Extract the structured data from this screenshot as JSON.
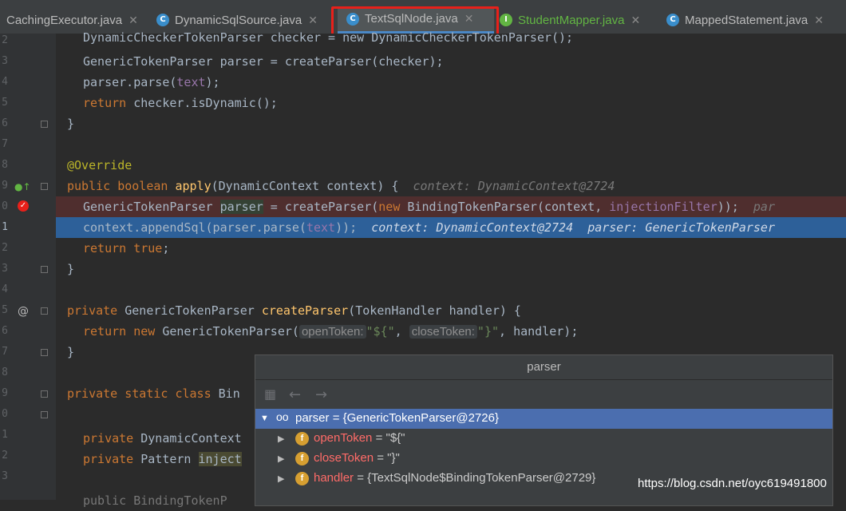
{
  "tabs": [
    {
      "label": "CachingExecutor.java",
      "icon": "class-icon",
      "color": "#bbbbbb"
    },
    {
      "label": "DynamicSqlSource.java",
      "icon": "class-icon",
      "color": "#bbbbbb"
    },
    {
      "label": "TextSqlNode.java",
      "icon": "class-icon",
      "color": "#bbbbbb",
      "active": true
    },
    {
      "label": "StudentMapper.java",
      "icon": "interface-icon",
      "color": "#62b543"
    },
    {
      "label": "MappedStatement.java",
      "icon": "class-icon",
      "color": "#bbbbbb"
    }
  ],
  "line_numbers": [
    "2",
    "3",
    "4",
    "5",
    "6",
    "7",
    "8",
    "9",
    "0",
    "1",
    "2",
    "3",
    "4",
    "5",
    "6",
    "7",
    "8",
    "9",
    "0",
    "1",
    "2",
    "3"
  ],
  "code": {
    "l1": "DynamicCheckerTokenParser checker = new DynamicCheckerTokenParser();",
    "l2_type": "GenericTokenParser",
    "l2_var": " parser = ",
    "l2_fn": "createParser",
    "l2_arg": "(checker);",
    "l3_a": "parser.parse(",
    "l3_b": "text",
    "l3_c": ");",
    "l4_kw": "return",
    "l4_rest": " checker.isDynamic();",
    "l5": "}",
    "l7": "@Override",
    "l8_kw": "public boolean ",
    "l8_fn": "apply",
    "l8_rest": "(DynamicContext context) {",
    "l8_hint": "context: DynamicContext@2724",
    "l9_a": "GenericTokenParser ",
    "l9_b": "parser",
    "l9_c": " = createParser(",
    "l9_kw": "new",
    "l9_d": " BindingTokenParser(context, ",
    "l9_e": "injectionFilter",
    "l9_f": "));",
    "l9_hint": "par",
    "l10_a": "context.appendSql(parser.parse(",
    "l10_b": "text",
    "l10_c": "));",
    "l10_hint1": "context: DynamicContext@2724",
    "l10_hint2": "parser: GenericTokenParser",
    "l11_kw": "return true",
    "l11_rest": ";",
    "l12": "}",
    "l14_kw": "private",
    "l14_a": " GenericTokenParser ",
    "l14_fn": "createParser",
    "l14_b": "(TokenHandler handler) {",
    "l15_kw": "return new",
    "l15_a": " GenericTokenParser(",
    "l15_p1": "openToken:",
    "l15_s1": "\"${\"",
    "l15_comma": ", ",
    "l15_p2": "closeToken:",
    "l15_s2": "\"}\"",
    "l15_end": ", handler);",
    "l16": "}",
    "l18_kw": "private static class",
    "l18_a": " Bin",
    "l20_kw": "private",
    "l20_a": " DynamicContext",
    "l21_kw": "private",
    "l21_a": " Pattern ",
    "l21_b": "inject",
    "l23_a": "public BindingTokenP"
  },
  "popup": {
    "title": "parser",
    "root": {
      "name": "parser",
      "value": " = {GenericTokenParser@2726}"
    },
    "fields": [
      {
        "name": "openToken",
        "value": " = \"${\""
      },
      {
        "name": "closeToken",
        "value": " = \"}\""
      },
      {
        "name": "handler",
        "value": " = {TextSqlNode$BindingTokenParser@2729}"
      }
    ]
  },
  "watermark": "https://blog.csdn.net/oyc619491800",
  "colors": {
    "breakpoint": "#e8201a",
    "selection": "#2d6099",
    "tab_highlight": "#e8201a"
  }
}
